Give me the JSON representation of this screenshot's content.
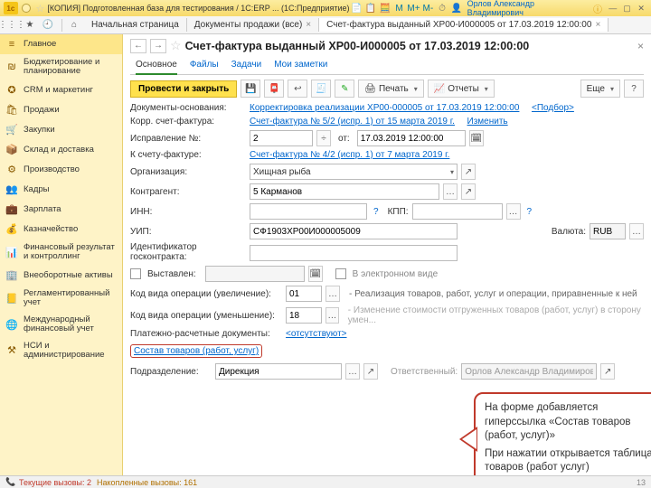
{
  "titlebar": {
    "text": "[КОПИЯ] Подготовленная база для тестирования / 1С:ERP ... (1С:Предприятие)",
    "user": "Орлов Александр Владимирович"
  },
  "tabs": {
    "home": "Начальная страница",
    "docs": "Документы продажи (все)",
    "active": "Счет-фактура выданный ХР00-И000005 от 17.03.2019 12:00:00"
  },
  "sidebar": {
    "items": [
      "Главное",
      "Бюджетирование и планирование",
      "CRM и маркетинг",
      "Продажи",
      "Закупки",
      "Склад и доставка",
      "Производство",
      "Кадры",
      "Зарплата",
      "Казначейство",
      "Финансовый результат и контроллинг",
      "Внеоборотные активы",
      "Регламентированный учет",
      "Международный финансовый учет",
      "НСИ и администрирование"
    ]
  },
  "header": {
    "title": "Счет-фактура выданный ХР00-И000005 от 17.03.2019 12:00:00"
  },
  "subnav": {
    "main": "Основное",
    "files": "Файлы",
    "tasks": "Задачи",
    "notes": "Мои заметки"
  },
  "toolbar": {
    "post_close": "Провести и закрыть",
    "print": "Печать",
    "reports": "Отчеты",
    "more": "Еще"
  },
  "form": {
    "l_basis": "Документы-основания:",
    "v_basis": "Корректировка реализации ХР00-000005 от 17.03.2019 12:00:00",
    "v_basis_pick": "<Подбор>",
    "l_corr": "Корр. счет-фактура:",
    "v_corr": "Счет-фактура № 5/2 (испр. 1) от 15 марта 2019 г.",
    "v_corr_change": "Изменить",
    "l_fix": "Исправление №:",
    "v_fix": "2",
    "l_ot": "от:",
    "v_date": "17.03.2019 12:00:00",
    "l_kschet": "К счету-фактуре:",
    "v_kschet": "Счет-фактура № 4/2 (испр. 1) от 7 марта 2019 г.",
    "l_org": "Организация:",
    "v_org": "Хищная рыба",
    "l_kontr": "Контрагент:",
    "v_kontr": "5 Карманов",
    "l_inn": "ИНН:",
    "l_kpp": "КПП:",
    "l_uip": "УИП:",
    "v_uip": "СФ1903ХР00И000005009",
    "l_val": "Валюта:",
    "v_val": "RUB",
    "l_idgk": "Идентификатор госконтракта:",
    "l_vyst": "Выставлен:",
    "l_elec": "В электронном виде",
    "l_kodeup": "Код вида операции (увеличение):",
    "v_kodeup": "01",
    "v_kodeup_desc": "- Реализация товаров, работ, услуг и операции, приравненные к ней",
    "l_kodedn": "Код вида операции (уменьшение):",
    "v_kodedn": "18",
    "v_kodedn_desc": "- Изменение стоимости отгруженных товаров (работ, услуг) в сторону умен...",
    "l_prd": "Платежно-расчетные документы:",
    "v_prd": "<отсутствуют>",
    "link_sostav": "Состав товаров (работ, услуг)",
    "l_podr": "Подразделение:",
    "v_podr": "Дирекция",
    "l_otv": "Ответственный:",
    "v_otv": "Орлов Александр Владимиров"
  },
  "callout": {
    "line1": "На форме добавляется гиперссылка «Состав товаров (работ, услуг)»",
    "line2": "При нажатии открывается таблица товаров (работ услуг)"
  },
  "status": {
    "cur": "Текущие вызовы: 2",
    "acc": "Накопленные вызовы: 161",
    "page": "13"
  }
}
